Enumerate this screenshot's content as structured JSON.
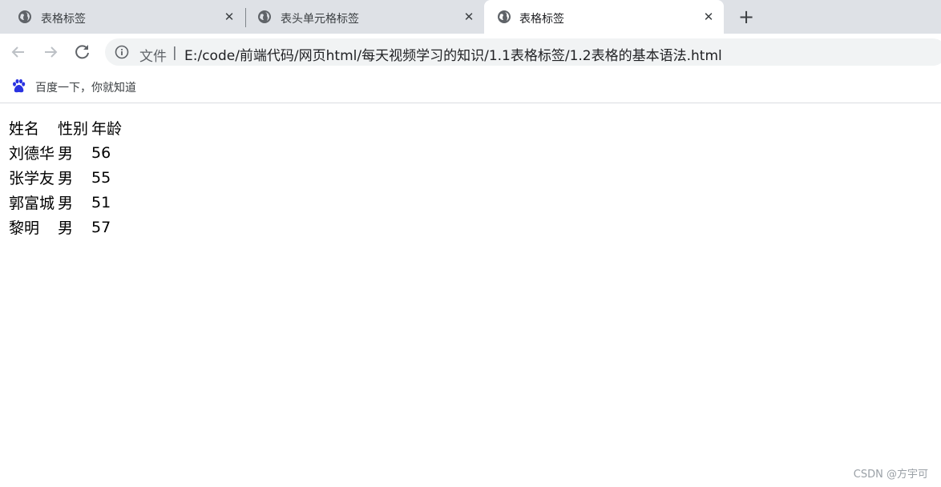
{
  "tabs": [
    {
      "title": "表格标签",
      "active": false
    },
    {
      "title": "表头单元格标签",
      "active": false
    },
    {
      "title": "表格标签",
      "active": true
    }
  ],
  "new_tab_label": "+",
  "close_glyph": "✕",
  "toolbar": {
    "back_icon": "arrow-left-icon",
    "forward_icon": "arrow-right-icon",
    "reload_icon": "reload-icon"
  },
  "omnibox": {
    "scheme": "文件",
    "divider": "|",
    "url": "E:/code/前端代码/网页html/每天视频学习的知识/1.1表格标签/1.2表格的基本语法.html"
  },
  "bookmarks": [
    {
      "label": "百度一下，你就知道",
      "icon": "baidu-paw-icon"
    }
  ],
  "table": {
    "headers": [
      "姓名",
      "性别",
      "年龄"
    ],
    "rows": [
      [
        "刘德华",
        "男",
        "56"
      ],
      [
        "张学友",
        "男",
        "55"
      ],
      [
        "郭富城",
        "男",
        "51"
      ],
      [
        "黎明",
        "男",
        "57"
      ]
    ]
  },
  "watermark": "CSDN @方宇可",
  "colors": {
    "tabstrip_bg": "#dee1e6",
    "active_tab_bg": "#ffffff",
    "omnibox_bg": "#f1f3f4",
    "baidu_blue": "#2932e1"
  }
}
